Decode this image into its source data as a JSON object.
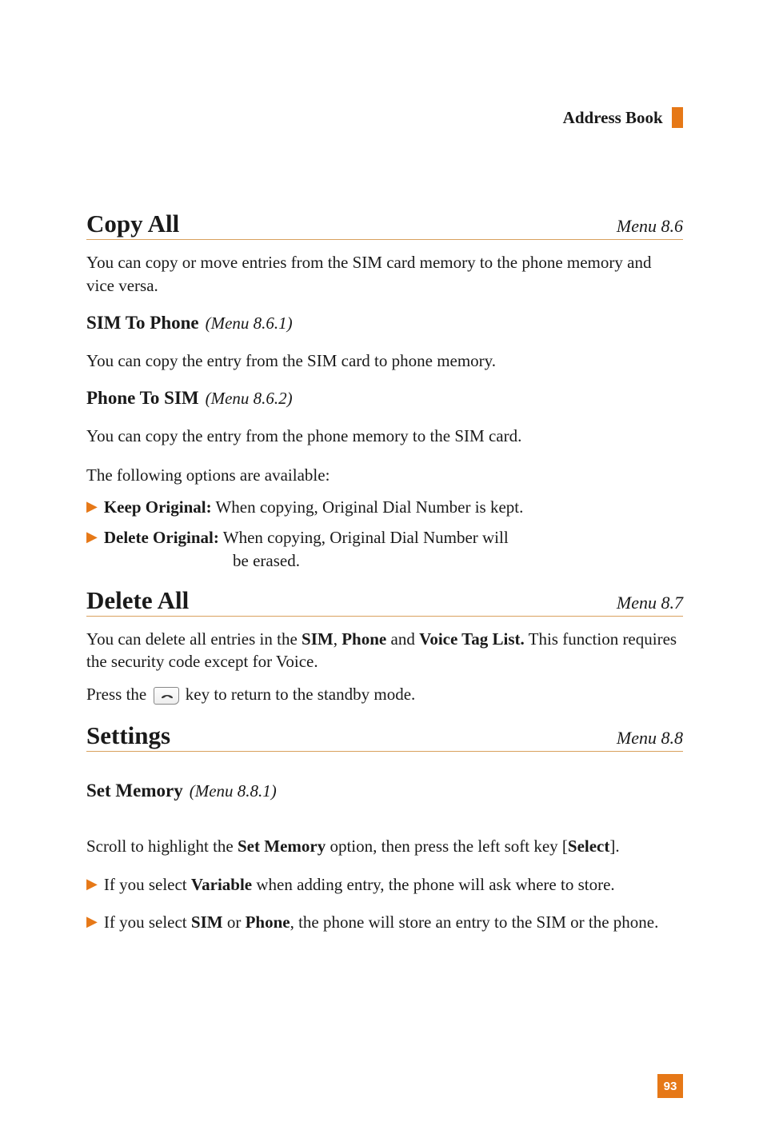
{
  "chapter": {
    "title": "Address Book"
  },
  "sections": {
    "copyAll": {
      "title": "Copy All",
      "menuRef": "Menu 8.6",
      "intro": "You can copy or move entries from the SIM card memory to the phone memory and vice versa.",
      "sub1": {
        "title": "SIM To Phone",
        "menuRef": "(Menu 8.6.1)",
        "body": "You can copy the entry from the SIM card to phone memory."
      },
      "sub2": {
        "title": "Phone To SIM",
        "menuRef": "(Menu 8.6.2)",
        "body": "You can copy the entry from the phone memory to the SIM card.",
        "optsIntro": "The following options are available:",
        "opt1Label": "Keep Original:",
        "opt1Rest": " When copying, Original Dial Number is kept.",
        "opt2Label": "Delete Original:",
        "opt2Rest": " When copying, Original Dial Number will",
        "opt2Cont": "be erased."
      }
    },
    "deleteAll": {
      "title": "Delete All",
      "menuRef": "Menu 8.7",
      "p1Pre": "You can delete all entries in the ",
      "p1B1": "SIM",
      "p1Mid1": ", ",
      "p1B2": "Phone",
      "p1Mid2": " and ",
      "p1B3": "Voice Tag List.",
      "p1Post": " This function requires the security code except for Voice.",
      "p2Pre": "Press the ",
      "p2Post": " key to return to the standby mode."
    },
    "settings": {
      "title": "Settings",
      "menuRef": "Menu 8.8",
      "sub1": {
        "title": "Set Memory",
        "menuRef": "(Menu 8.8.1)",
        "p1Pre": "Scroll to highlight the ",
        "p1B": "Set Memory",
        "p1Mid": " option, then press the left soft key [",
        "p1B2": "Select",
        "p1Post": "].",
        "opt1Pre": "If you select ",
        "opt1B": "Variable",
        "opt1Post": " when adding entry, the phone will ask where to store.",
        "opt2Pre": "If you select ",
        "opt2B1": "SIM",
        "opt2Mid": " or ",
        "opt2B2": "Phone",
        "opt2Post": ", the phone will store an entry to the SIM or the phone."
      }
    }
  },
  "pageNumber": "93"
}
